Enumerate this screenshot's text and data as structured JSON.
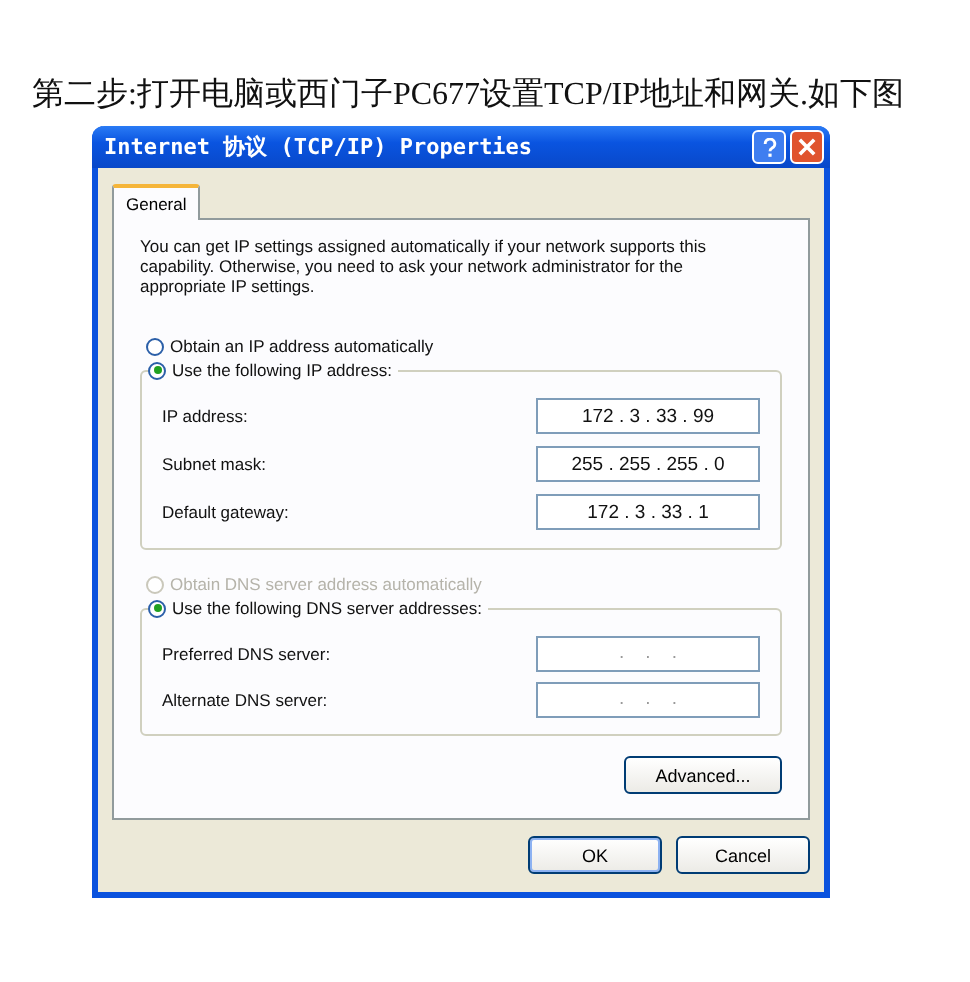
{
  "caption": "第二步:打开电脑或西门子PC677设置TCP/IP地址和网关.如下图",
  "dialog": {
    "title": "Internet 协议 (TCP/IP) Properties",
    "tabs": [
      {
        "label": "General",
        "selected": true
      }
    ],
    "intro": "You can get IP settings assigned automatically if your network supports this capability. Otherwise, you need to ask your network administrator for the appropriate IP settings.",
    "ip_options": [
      {
        "label": "Obtain an IP address automatically",
        "selected": false,
        "disabled": false
      },
      {
        "label": "Use the following IP address:",
        "selected": true,
        "disabled": false
      }
    ],
    "ip_fields": [
      {
        "label": "IP address:",
        "value": "172 . 3 . 33 . 99"
      },
      {
        "label": "Subnet mask:",
        "value": "255 . 255 . 255 . 0"
      },
      {
        "label": "Default gateway:",
        "value": "172 . 3 . 33 . 1"
      }
    ],
    "dns_options": [
      {
        "label": "Obtain DNS server address automatically",
        "selected": false,
        "disabled": true
      },
      {
        "label": "Use the following DNS server addresses:",
        "selected": true,
        "disabled": false
      }
    ],
    "dns_fields": [
      {
        "label": "Preferred DNS server:",
        "value": ".    .    ."
      },
      {
        "label": "Alternate DNS server:",
        "value": ".    .    ."
      }
    ],
    "advanced_button": "Advanced...",
    "buttons": [
      "OK",
      "Cancel"
    ]
  }
}
